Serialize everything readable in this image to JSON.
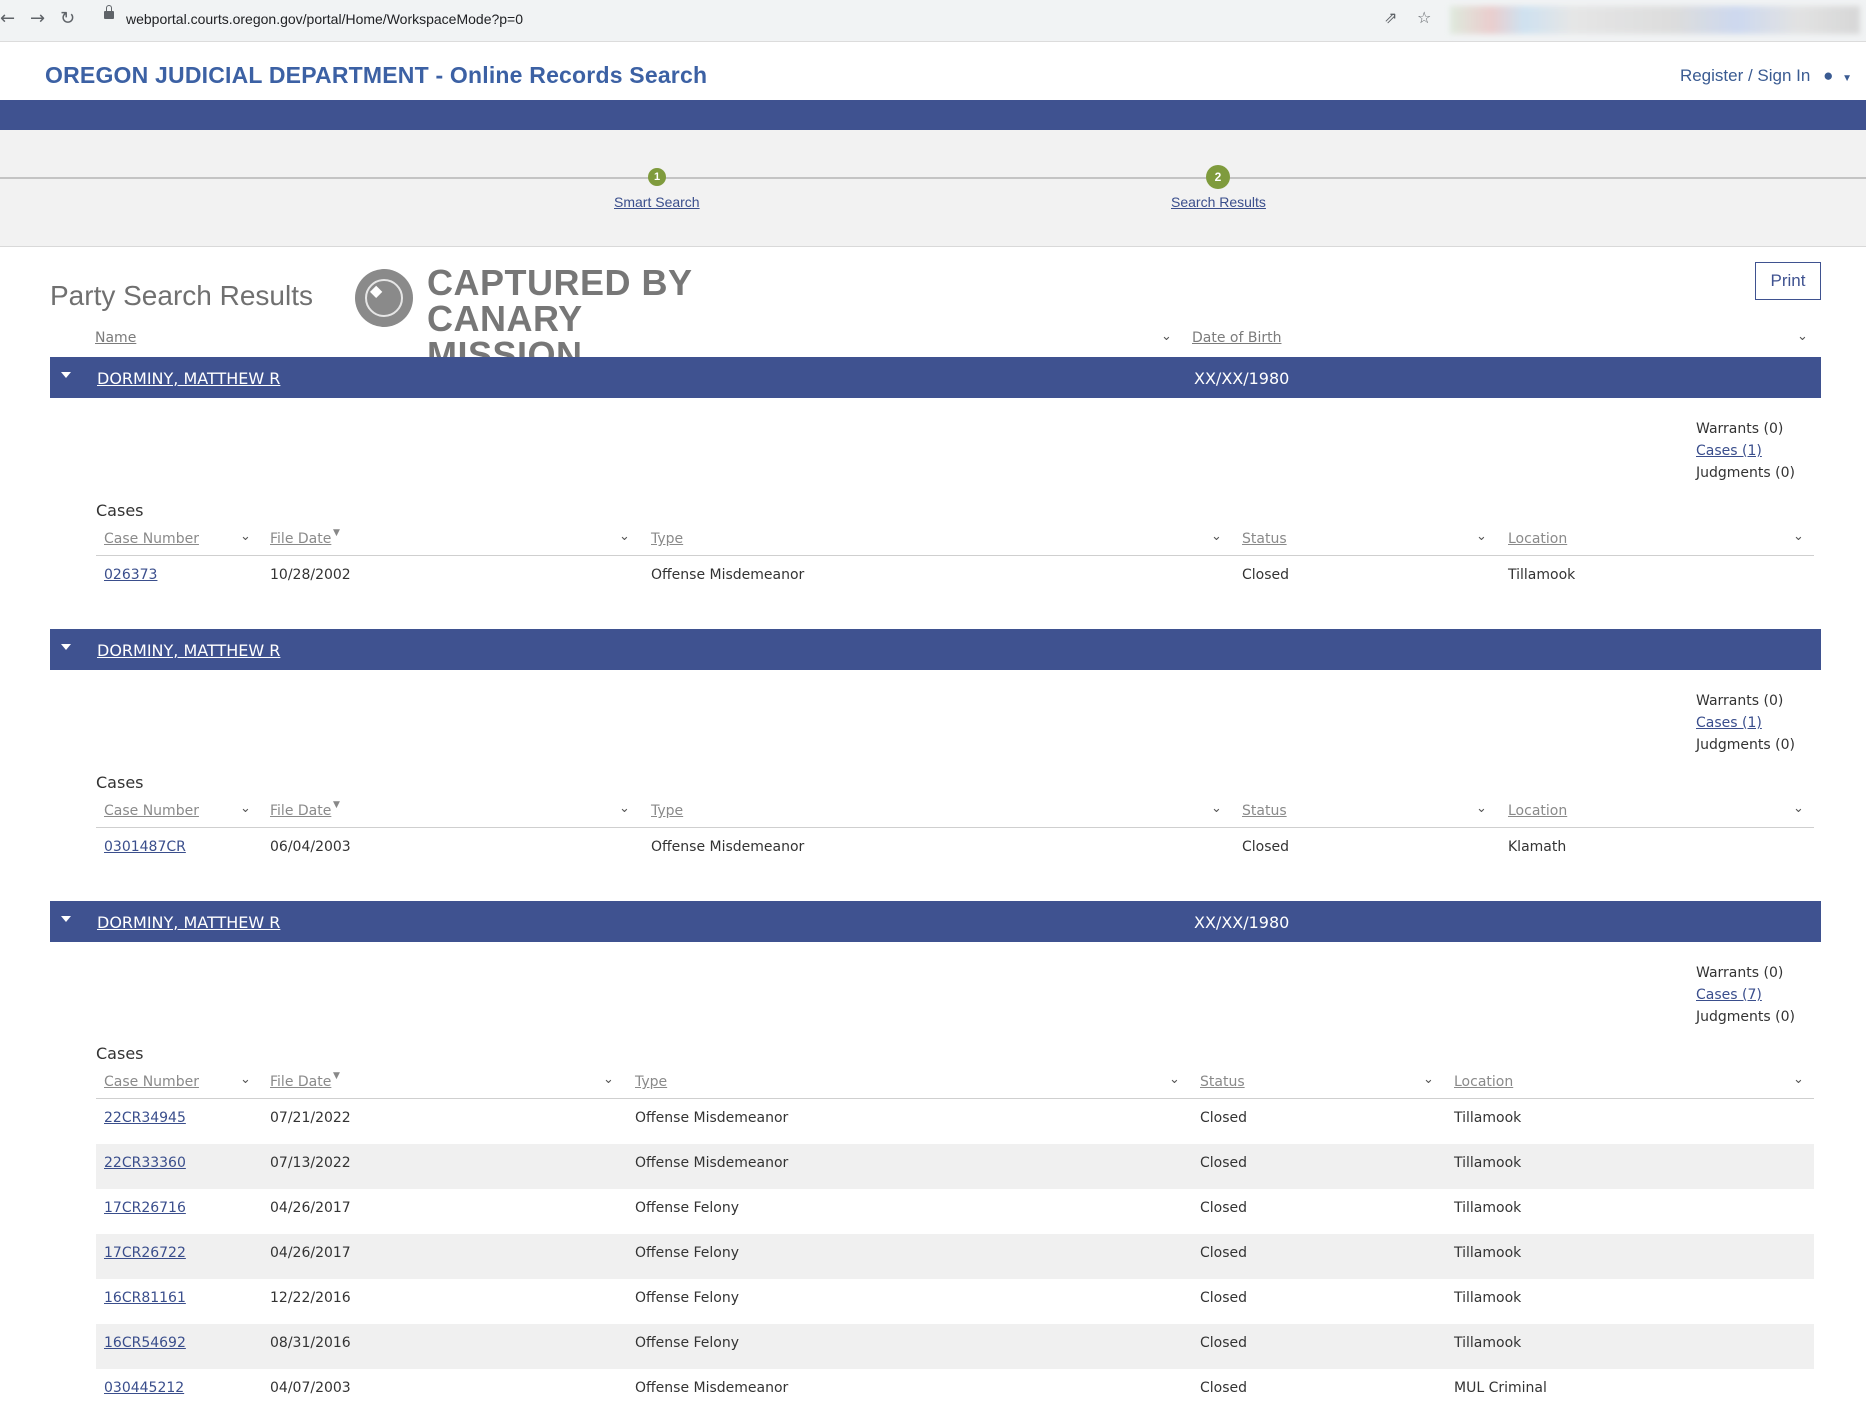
{
  "browser": {
    "url": "webportal.courts.oregon.gov/portal/Home/WorkspaceMode?p=0"
  },
  "header": {
    "title": "OREGON JUDICIAL DEPARTMENT - Online Records Search",
    "signin": "Register / Sign In"
  },
  "steps": [
    {
      "number": "1",
      "label": "Smart Search"
    },
    {
      "number": "2",
      "label": "Search Results"
    }
  ],
  "page": {
    "title": "Party Search Results",
    "print_label": "Print",
    "watermark_line1": "CAPTURED BY",
    "watermark_line2": "CANARY MISSION",
    "col_name": "Name",
    "col_dob": "Date of Birth"
  },
  "case_headers": {
    "case_number": "Case Number",
    "file_date": "File Date",
    "type": "Type",
    "status": "Status",
    "location": "Location",
    "cases_label": "Cases"
  },
  "parties": [
    {
      "name": "DORMINY, MATTHEW R",
      "dob": "XX/XX/1980",
      "warrants": "Warrants (0)",
      "cases": "Cases (1)",
      "judgments": "Judgments (0)",
      "rows": [
        {
          "case": "026373",
          "date": "10/28/2002",
          "type": "Offense Misdemeanor",
          "status": "Closed",
          "location": "Tillamook"
        }
      ]
    },
    {
      "name": "DORMINY, MATTHEW R",
      "dob": "",
      "warrants": "Warrants (0)",
      "cases": "Cases (1)",
      "judgments": "Judgments (0)",
      "rows": [
        {
          "case": "0301487CR",
          "date": "06/04/2003",
          "type": "Offense Misdemeanor",
          "status": "Closed",
          "location": "Klamath"
        }
      ]
    },
    {
      "name": "DORMINY, MATTHEW R",
      "dob": "XX/XX/1980",
      "warrants": "Warrants (0)",
      "cases": "Cases (7)",
      "judgments": "Judgments (0)",
      "rows": [
        {
          "case": "22CR34945",
          "date": "07/21/2022",
          "type": "Offense Misdemeanor",
          "status": "Closed",
          "location": "Tillamook"
        },
        {
          "case": "22CR33360",
          "date": "07/13/2022",
          "type": "Offense Misdemeanor",
          "status": "Closed",
          "location": "Tillamook"
        },
        {
          "case": "17CR26716",
          "date": "04/26/2017",
          "type": "Offense Felony",
          "status": "Closed",
          "location": "Tillamook"
        },
        {
          "case": "17CR26722",
          "date": "04/26/2017",
          "type": "Offense Felony",
          "status": "Closed",
          "location": "Tillamook"
        },
        {
          "case": "16CR81161",
          "date": "12/22/2016",
          "type": "Offense Felony",
          "status": "Closed",
          "location": "Tillamook"
        },
        {
          "case": "16CR54692",
          "date": "08/31/2016",
          "type": "Offense Felony",
          "status": "Closed",
          "location": "Tillamook"
        },
        {
          "case": "030445212",
          "date": "04/07/2003",
          "type": "Offense Misdemeanor",
          "status": "Closed",
          "location": "MUL Criminal"
        }
      ]
    }
  ]
}
